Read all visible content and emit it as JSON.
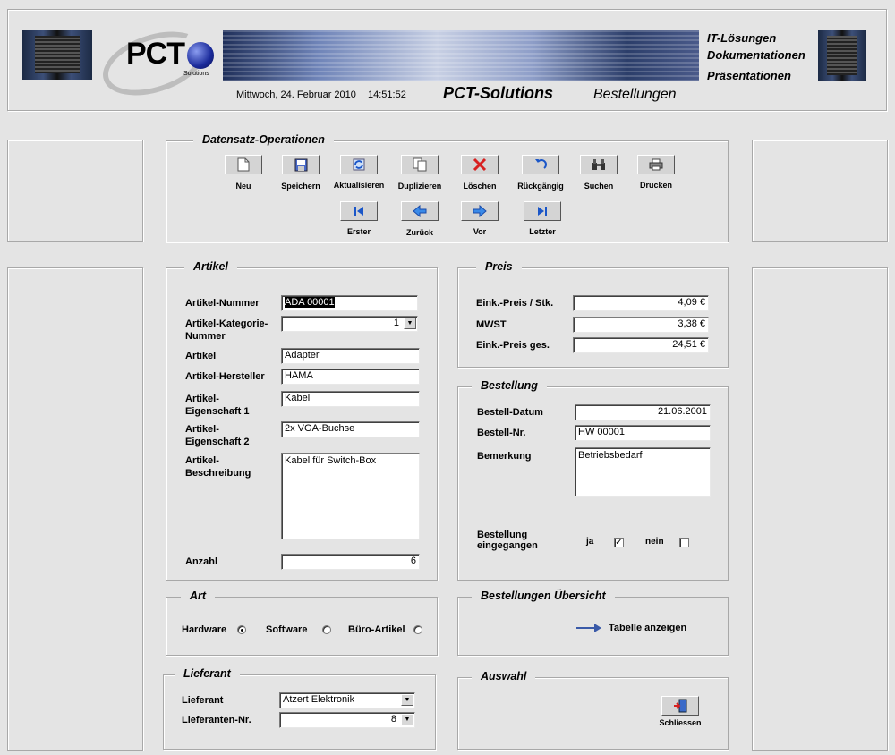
{
  "header": {
    "date": "Mittwoch, 24. Februar 2010",
    "time": "14:51:52",
    "company": "PCT-Solutions",
    "section": "Bestellungen",
    "logo_text": "PCT",
    "logo_sub": "Solutions",
    "taglines": [
      "IT-Lösungen",
      "Dokumentationen",
      "Präsentationen"
    ]
  },
  "ops": {
    "legend": "Datensatz-Operationen",
    "row1": [
      {
        "label": "Neu",
        "icon": "new-document-icon"
      },
      {
        "label": "Speichern",
        "icon": "save-icon"
      },
      {
        "label": "Aktualisieren",
        "icon": "refresh-icon"
      },
      {
        "label": "Duplizieren",
        "icon": "duplicate-icon"
      },
      {
        "label": "Löschen",
        "icon": "delete-icon"
      },
      {
        "label": "Rückgängig",
        "icon": "undo-icon"
      },
      {
        "label": "Suchen",
        "icon": "binoculars-icon"
      },
      {
        "label": "Drucken",
        "icon": "printer-icon"
      }
    ],
    "row2": [
      {
        "label": "Erster",
        "icon": "first-record-icon"
      },
      {
        "label": "Zurück",
        "icon": "previous-arrow-icon"
      },
      {
        "label": "Vor",
        "icon": "next-arrow-icon"
      },
      {
        "label": "Letzter",
        "icon": "last-record-icon"
      }
    ]
  },
  "artikel": {
    "legend": "Artikel",
    "nummer_label": "Artikel-Nummer",
    "nummer_value": "ADA 00001",
    "kategorie_label_1": "Artikel-Kategorie-",
    "kategorie_label_2": "Nummer",
    "kategorie_value": "1",
    "artikel_label": "Artikel",
    "artikel_value": "Adapter",
    "hersteller_label": "Artikel-Hersteller",
    "hersteller_value": "HAMA",
    "eig1_label_1": "Artikel-",
    "eig1_label_2": "Eigenschaft 1",
    "eig1_value": "Kabel",
    "eig2_label_1": "Artikel-",
    "eig2_label_2": "Eigenschaft 2",
    "eig2_value": "2x VGA-Buchse",
    "beschr_label_1": "Artikel-",
    "beschr_label_2": "Beschreibung",
    "beschr_value": "Kabel für Switch-Box",
    "anzahl_label": "Anzahl",
    "anzahl_value": "6"
  },
  "preis": {
    "legend": "Preis",
    "eink_label": "Eink.-Preis / Stk.",
    "eink_value": "4,09 €",
    "mwst_label": "MWST",
    "mwst_value": "3,38 €",
    "ges_label": "Eink.-Preis ges.",
    "ges_value": "24,51 €"
  },
  "bestellung": {
    "legend": "Bestellung",
    "datum_label": "Bestell-Datum",
    "datum_value": "21.06.2001",
    "nr_label": "Bestell-Nr.",
    "nr_value": "HW 00001",
    "bem_label": "Bemerkung",
    "bem_value": "Betriebsbedarf",
    "eing_label_1": "Bestellung",
    "eing_label_2": "eingegangen",
    "ja_label": "ja",
    "nein_label": "nein",
    "eingegangen": true
  },
  "art": {
    "legend": "Art",
    "options": [
      "Hardware",
      "Software",
      "Büro-Artikel"
    ],
    "selected": "Hardware"
  },
  "uebersicht": {
    "legend": "Bestellungen Übersicht",
    "link_label": "Tabelle anzeigen"
  },
  "lieferant": {
    "legend": "Lieferant",
    "name_label": "Lieferant",
    "name_value": "Atzert Elektronik",
    "nr_label": "Lieferanten-Nr.",
    "nr_value": "8"
  },
  "auswahl": {
    "legend": "Auswahl",
    "close_label": "Schliessen"
  },
  "colors": {
    "background": "#e4e4e4",
    "accent_arrow": "#3a5aa8",
    "delete_red": "#d82020"
  }
}
